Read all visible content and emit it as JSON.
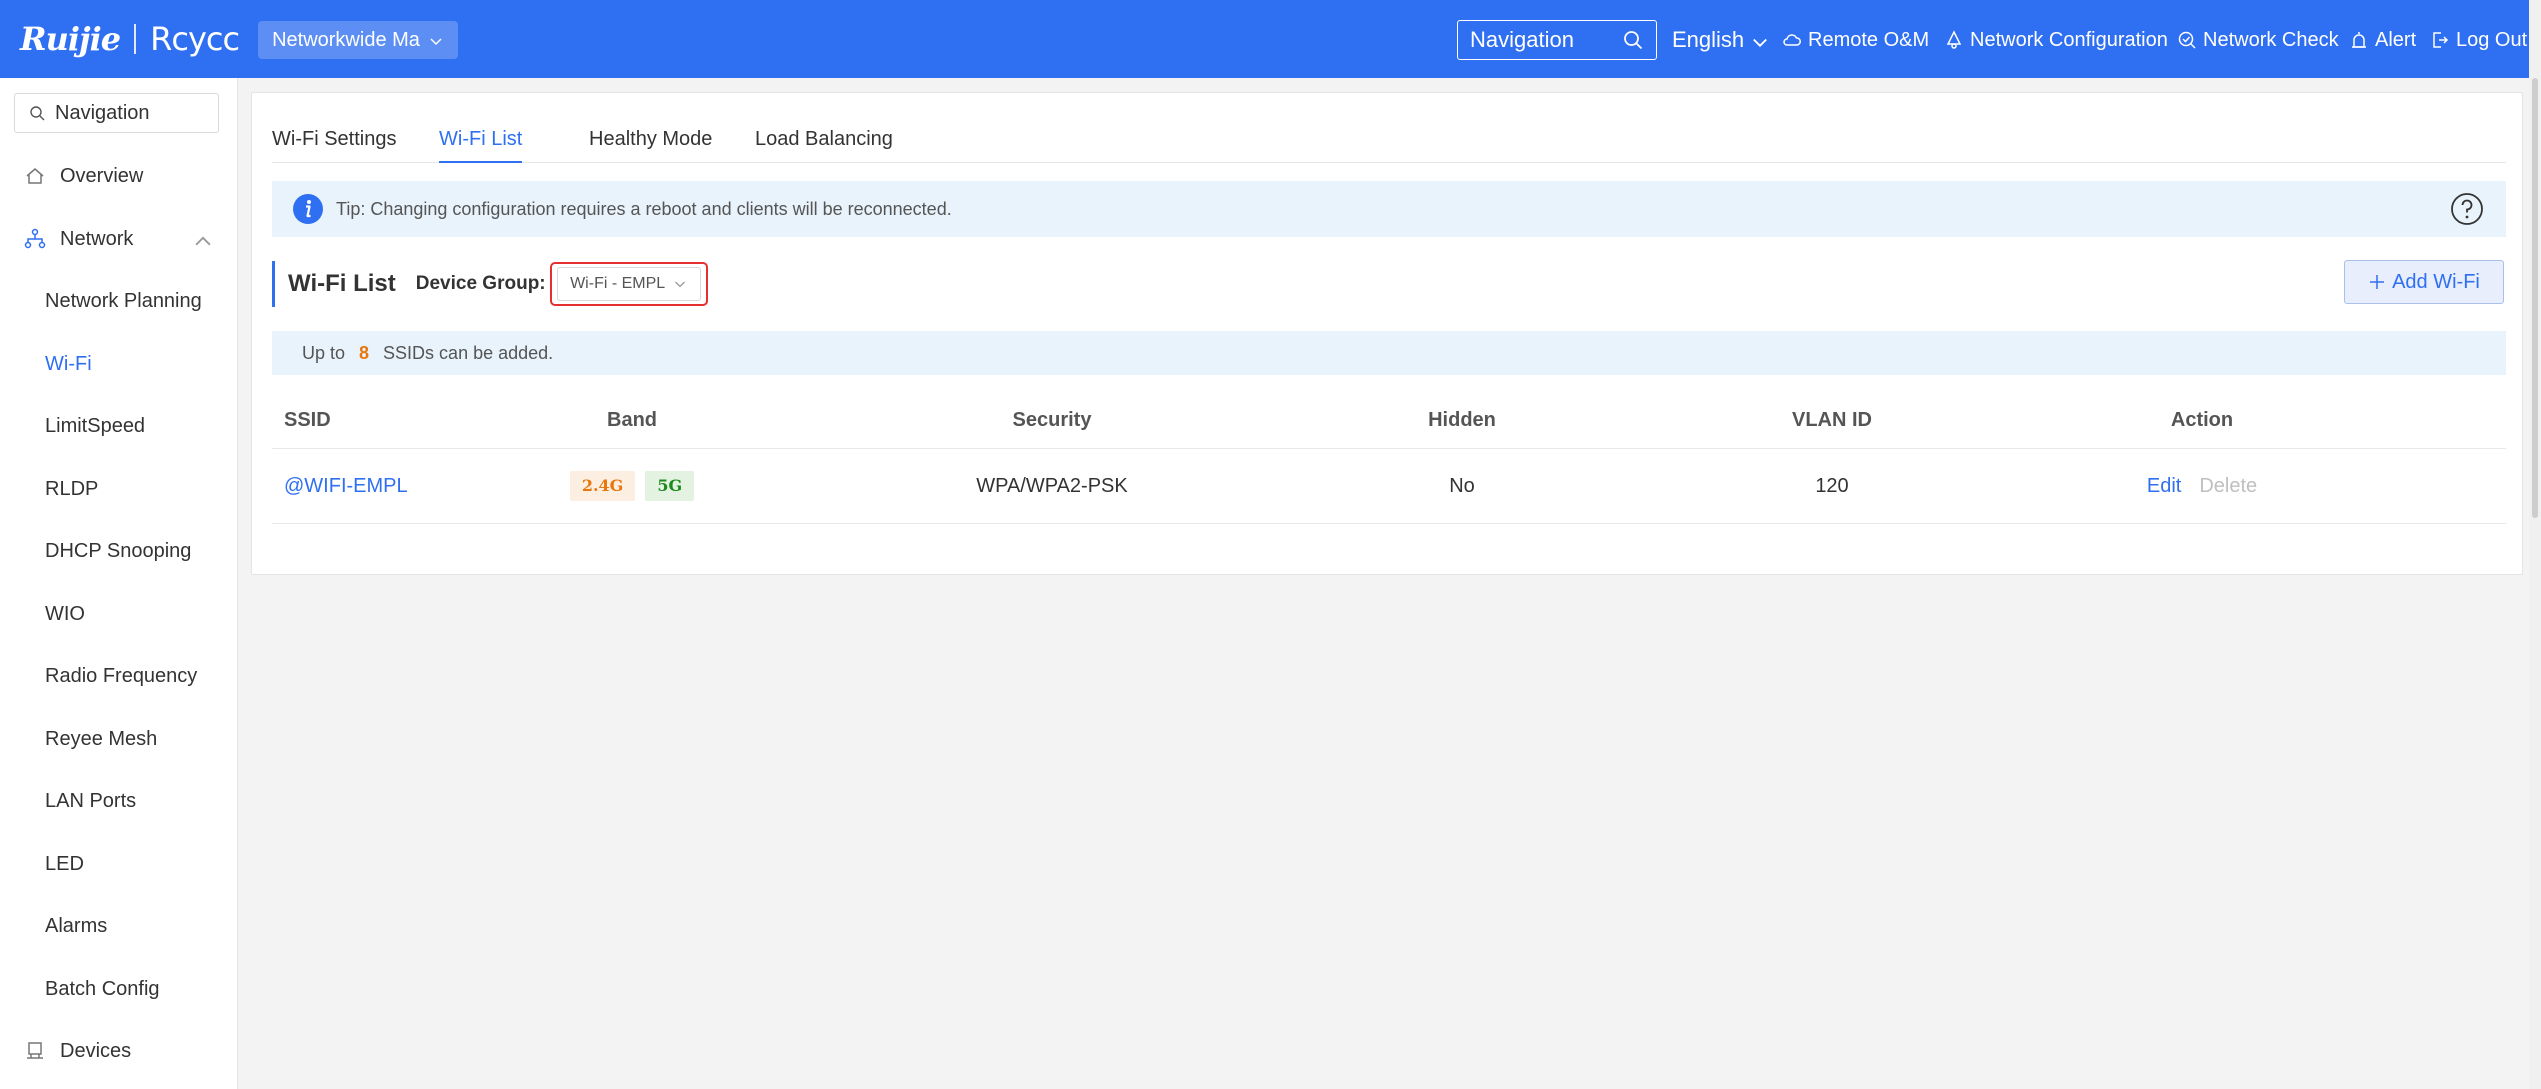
{
  "header": {
    "logo_brand": "Ruijie",
    "logo_sub": "Rcycc",
    "scope_label": "Networkwide Ma",
    "search_placeholder": "Navigation",
    "language": "English",
    "menu": {
      "remote": "Remote O&M",
      "network_config": "Network Configuration",
      "network_check": "Network Check",
      "alert": "Alert",
      "logout": "Log Out"
    },
    "bg_color": "#2f6ff1"
  },
  "sidebar": {
    "search_placeholder": "Navigation",
    "overview": "Overview",
    "network": "Network",
    "items": [
      "Network Planning",
      "Wi-Fi",
      "LimitSpeed",
      "RLDP",
      "DHCP Snooping",
      "WIO",
      "Radio Frequency",
      "Reyee Mesh",
      "LAN Ports",
      "LED",
      "Alarms",
      "Batch Config"
    ],
    "active_item": "Wi-Fi",
    "devices": "Devices"
  },
  "main": {
    "tabs": [
      "Wi-Fi Settings",
      "Wi-Fi List",
      "Healthy Mode",
      "Load Balancing"
    ],
    "active_tab": "Wi-Fi List",
    "tip": "Tip: Changing configuration requires a reboot and clients will be reconnected.",
    "list_title": "Wi-Fi List",
    "device_group_label": "Device Group:",
    "device_group_value": "Wi-Fi - EMPL",
    "add_button": "Add Wi-Fi",
    "quota": {
      "prefix": "Up to",
      "count": "8",
      "suffix": "SSIDs can be added."
    },
    "table": {
      "columns": [
        "SSID",
        "Band",
        "Security",
        "Hidden",
        "VLAN ID",
        "Action"
      ],
      "rows": [
        {
          "ssid": "@WIFI-EMPL",
          "bands": [
            "2.4G",
            "5G"
          ],
          "security": "WPA/WPA2-PSK",
          "hidden": "No",
          "vlan": "120",
          "actions": [
            "Edit",
            "Delete"
          ]
        }
      ]
    }
  }
}
